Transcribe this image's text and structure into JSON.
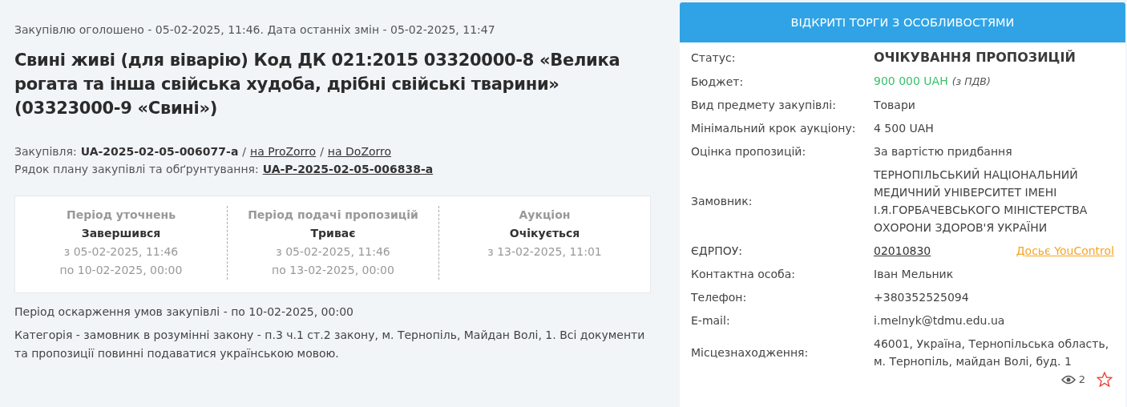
{
  "announced": "Закупівлю оголошено - 05-02-2025, 11:46. Дата останніх змін - 05-02-2025, 11:47",
  "title": "Свині живі (для віварію) Код ДК 021:2015 03320000-8 «Велика рогата та інша свійська худоба, дрібні свійські тварини» (03323000-9 «Свині»)",
  "procurement": {
    "label": "Закупівля:",
    "id": "UA-2025-02-05-006077-a",
    "separator": "/",
    "links": [
      "на ProZorro",
      "на DoZorro"
    ]
  },
  "plan": {
    "label": "Рядок плану закупівлі та обґрунтування:",
    "id": "UA-P-2025-02-05-006838-a"
  },
  "periods": [
    {
      "title": "Період уточнень",
      "status": "Завершився",
      "lines": [
        "з 05-02-2025, 11:46",
        "по 10-02-2025, 00:00"
      ]
    },
    {
      "title": "Період подачі пропозицій",
      "status": "Триває",
      "lines": [
        "з 05-02-2025, 11:46",
        "по 13-02-2025, 00:00"
      ]
    },
    {
      "title": "Аукціон",
      "status": "Очікується",
      "lines": [
        "з 13-02-2025, 11:01"
      ]
    }
  ],
  "appeal": "Період оскарження умов закупівлі - по 10-02-2025, 00:00",
  "category": "Категорія - замовник в розумінні закону - п.3 ч.1 ст.2 закону, м. Тернопіль, Майдан Волі, 1. Всі документи та пропозиції повинні подаватися українською мовою.",
  "panel": {
    "header": "ВІДКРИТІ ТОРГИ З ОСОБЛИВОСТЯМИ",
    "rows": [
      {
        "kind": "status",
        "label": "Статус:",
        "value": "ОЧІКУВАННЯ ПРОПОЗИЦІЙ"
      },
      {
        "kind": "budget",
        "label": "Бюджет:",
        "value": "900 000 UAH",
        "note": "(з ПДВ)"
      },
      {
        "kind": "text",
        "label": "Вид предмету закупівлі:",
        "value": "Товари"
      },
      {
        "kind": "text",
        "label": "Мінімальний крок аукціону:",
        "value": "4 500 UAH"
      },
      {
        "kind": "text",
        "label": "Оцінка пропозицій:",
        "value": "За вартістю придбання"
      },
      {
        "kind": "text",
        "label": "Замовник:",
        "value": "ТЕРНОПІЛЬСЬКИЙ НАЦІОНАЛЬНИЙ МЕДИЧНИЙ УНІВЕРСИТЕТ ІМЕНІ І.Я.ГОРБАЧЕВСЬКОГО МІНІСТЕРСТВА ОХОРОНИ ЗДОРОВ'Я УКРАЇНИ"
      },
      {
        "kind": "code",
        "label": "ЄДРПОУ:",
        "value": "02010830",
        "link": "Досьє YouControl"
      },
      {
        "kind": "text",
        "label": "Контактна особа:",
        "value": "Іван Мельник"
      },
      {
        "kind": "text",
        "label": "Телефон:",
        "value": "+380352525094"
      },
      {
        "kind": "text",
        "label": "E-mail:",
        "value": "i.melnyk@tdmu.edu.ua"
      },
      {
        "kind": "text",
        "label": "Місцезнаходження:",
        "value": "46001, Україна, Тернопільська область, м. Тернопіль, майдан Волі, буд. 1"
      }
    ],
    "views": "2",
    "favorite": false
  }
}
